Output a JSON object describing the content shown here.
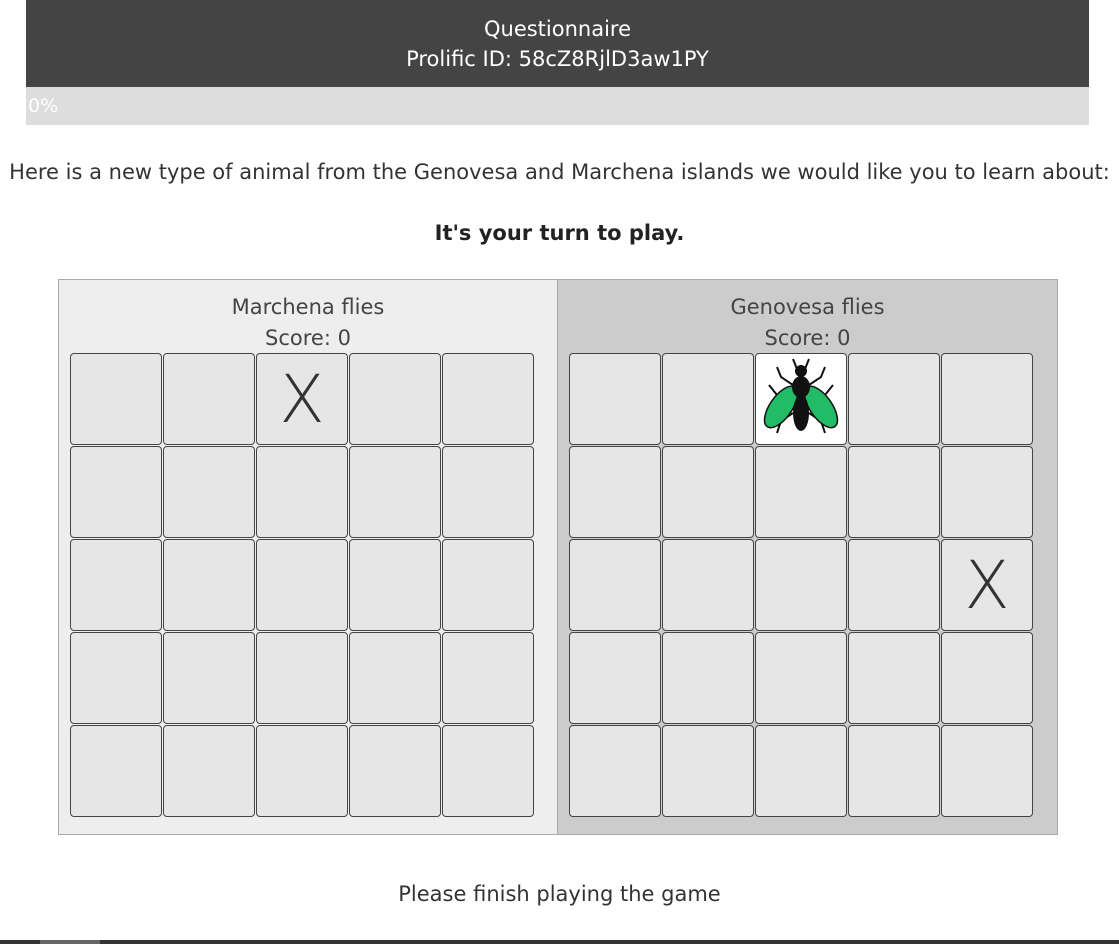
{
  "header": {
    "title": "Questionnaire",
    "prolific": "Prolific ID: 58cZ8RjlD3aw1PY"
  },
  "progress": {
    "label": "0%",
    "value": 0
  },
  "intro": "Here is a new type of animal from the Genovesa and Marchena islands we would like you to learn about:",
  "turn": "It's your turn to play.",
  "panels": {
    "left": {
      "title": "Marchena flies",
      "score": "Score: 0",
      "cells": [
        "",
        "",
        "X",
        "",
        "",
        "",
        "",
        "",
        "",
        "",
        "",
        "",
        "",
        "",
        "",
        "",
        "",
        "",
        "",
        "",
        "",
        "",
        "",
        "",
        ""
      ]
    },
    "right": {
      "title": "Genovesa flies",
      "score": "Score: 0",
      "cells": [
        "",
        "",
        "fly",
        "",
        "",
        "",
        "",
        "",
        "",
        "",
        "",
        "",
        "",
        "",
        "X",
        "",
        "",
        "",
        "",
        "",
        "",
        "",
        "",
        "",
        ""
      ]
    }
  },
  "fly_icon": "fly-icon",
  "colors": {
    "header_bg": "#444444",
    "fly_wing": "#22bb66"
  },
  "footer": "Please finish playing the game"
}
